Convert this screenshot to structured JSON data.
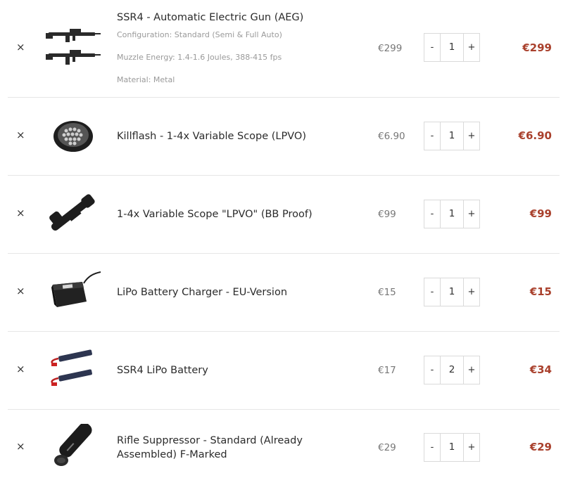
{
  "cart": {
    "items": [
      {
        "remove": "×",
        "name": "SSR4 - Automatic Electric Gun (AEG)",
        "meta": [
          "Configuration: Standard (Semi & Full Auto)",
          "Muzzle Energy: 1.4-1.6 Joules, 388-415 fps",
          "Material: Metal"
        ],
        "price": "€299",
        "qty_minus": "-",
        "qty": "1",
        "qty_plus": "+",
        "subtotal": "€299",
        "image_icon": "rifle-icon"
      },
      {
        "remove": "×",
        "name": "Killflash - 1-4x Variable Scope (LPVO)",
        "price": "€6.90",
        "qty_minus": "-",
        "qty": "1",
        "qty_plus": "+",
        "subtotal": "€6.90",
        "image_icon": "killflash-icon"
      },
      {
        "remove": "×",
        "name": "1-4x Variable Scope \"LPVO\" (BB Proof)",
        "price": "€99",
        "qty_minus": "-",
        "qty": "1",
        "qty_plus": "+",
        "subtotal": "€99",
        "image_icon": "scope-icon"
      },
      {
        "remove": "×",
        "name": "LiPo Battery Charger - EU-Version",
        "price": "€15",
        "qty_minus": "-",
        "qty": "1",
        "qty_plus": "+",
        "subtotal": "€15",
        "image_icon": "charger-icon"
      },
      {
        "remove": "×",
        "name": "SSR4 LiPo Battery",
        "price": "€17",
        "qty_minus": "-",
        "qty": "2",
        "qty_plus": "+",
        "subtotal": "€34",
        "image_icon": "battery-icon"
      },
      {
        "remove": "×",
        "name_line1": "Rifle Suppressor - Standard (Already",
        "name_line2": "Assembled) F-Marked",
        "price": "€29",
        "qty_minus": "-",
        "qty": "1",
        "qty_plus": "+",
        "subtotal": "€29",
        "image_icon": "suppressor-icon"
      }
    ],
    "colors": {
      "subtotal": "#a9402c",
      "price": "#777777",
      "divider": "#e6e6e6"
    }
  }
}
